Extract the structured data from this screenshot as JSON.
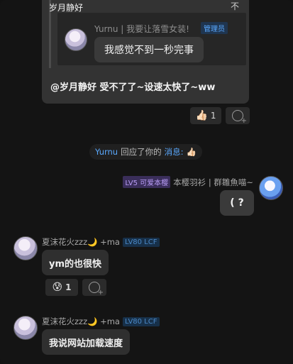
{
  "quoted_card": {
    "header": "岁月静好",
    "header_icon": "pin-icon",
    "nested_author": "Yurnu | 我要让落雪女装!",
    "nested_badge": "管理员",
    "nested_text": "我感觉不到一秒完事",
    "body_text": "@岁月静好 受不了了~设速太快了~ww"
  },
  "reaction_1": {
    "emoji": "👍🏻",
    "count": "1"
  },
  "notice": {
    "user": "Yurnu",
    "action": "回应了你的",
    "target": "消息:",
    "emoji": "👍🏻"
  },
  "right_message": {
    "badge": "LV5 可爱本樱",
    "author": "本樱羽衫 | 群雛魚喵~",
    "text": "( ?"
  },
  "left_message_1": {
    "author": "夏沫花火zzz🌙 +ma",
    "badge": "LV80 LCF",
    "text": "ym的也很快",
    "reaction_emoji": "😰",
    "reaction_count": "1"
  },
  "left_message_2": {
    "author": "夏沫花火zzz🌙 +ma",
    "badge": "LV80 LCF",
    "text": "我说网站加载速度"
  }
}
